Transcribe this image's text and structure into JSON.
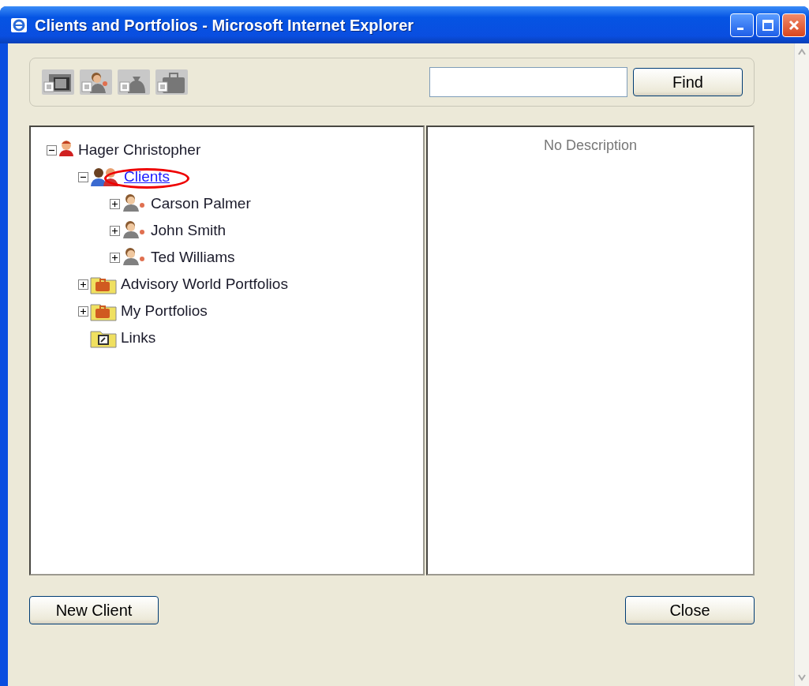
{
  "window": {
    "title": "Clients and Portfolios - Microsoft Internet Explorer"
  },
  "toolbar": {
    "icons": [
      {
        "kind": "folder"
      },
      {
        "kind": "client"
      },
      {
        "kind": "bag"
      },
      {
        "kind": "briefcase"
      }
    ],
    "find_button": "Find"
  },
  "tree": [
    {
      "label": "Hager Christopher",
      "kind": "person",
      "expanded": true,
      "selected": false,
      "circled": false,
      "children": [
        {
          "label": "Clients",
          "kind": "group",
          "expanded": true,
          "selected": true,
          "circled": true,
          "children": [
            {
              "label": "Carson Palmer",
              "kind": "client",
              "expanded": false,
              "selected": false,
              "circled": false
            },
            {
              "label": "John Smith",
              "kind": "client",
              "expanded": false,
              "selected": false,
              "circled": false
            },
            {
              "label": "Ted Williams",
              "kind": "client",
              "expanded": false,
              "selected": false,
              "circled": false
            }
          ]
        },
        {
          "label": "Advisory World Portfolios",
          "kind": "portfolio-folder",
          "expanded": false,
          "selected": false,
          "circled": false
        },
        {
          "label": "My Portfolios",
          "kind": "portfolio-folder",
          "expanded": false,
          "selected": false,
          "circled": false
        },
        {
          "label": "Links",
          "kind": "links-folder",
          "selected": false,
          "circled": false
        }
      ]
    }
  ],
  "description": "No Description",
  "buttons": {
    "new_client": "New Client",
    "close": "Close"
  }
}
